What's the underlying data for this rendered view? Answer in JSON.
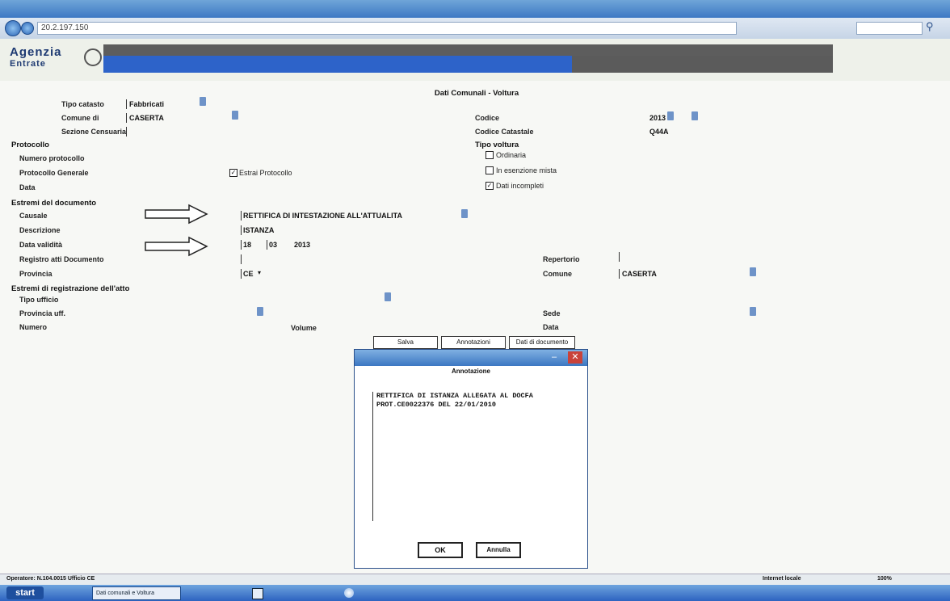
{
  "browser": {
    "url": "20.2.197.150",
    "search_icon": "magnifier-icon"
  },
  "app": {
    "logo_line1": "Agenzia",
    "logo_line2": "Entrate"
  },
  "form": {
    "title": "Dati Comunali - Voltura",
    "tipo_catasto_label": "Tipo catasto",
    "tipo_catasto_value": "Fabbricati",
    "comune_label": "Comune di",
    "comune_value": "CASERTA",
    "sezione_label": "Sezione Censuaria",
    "codice_label": "Codice",
    "codice_value": "2013",
    "codice_catastale_label": "Codice Catastale",
    "codice_catastale_value": "Q44A",
    "tipo_voltura_label": "Tipo voltura",
    "opt_ordinaria": "Ordinaria",
    "opt_mista": "In esenzione mista",
    "opt_dati": "Dati incompleti",
    "protocollo_label": "Protocollo",
    "numero_protocollo_label": "Numero protocollo",
    "protocollo_generale_label": "Protocollo Generale",
    "estrai_protocollo_label": "Estrai Protocollo",
    "data_label": "Data",
    "estremi_doc_label": "Estremi del documento",
    "causale_label": "Causale",
    "causale_value": "RETTIFICA DI INTESTAZIONE ALL'ATTUALITA",
    "descrizione_label": "Descrizione",
    "descrizione_value": "ISTANZA",
    "data_validita_label": "Data validità",
    "data_d": "18",
    "data_m": "03",
    "data_y": "2013",
    "registro_label": "Registro atti Documento",
    "repertorio_label": "Repertorio",
    "provincia_label": "Provincia",
    "provincia_value": "CE",
    "comune2_label": "Comune",
    "comune2_value": "CASERTA",
    "estremi_reg_label": "Estremi di registrazione dell'atto",
    "tipo_ufficio_label": "Tipo ufficio",
    "provincia_uff_label": "Provincia uff.",
    "sede_label": "Sede",
    "numero_label": "Numero",
    "volume_label": "Volume",
    "data2_label": "Data",
    "btn_salva": "Salva",
    "btn_annotazioni": "Annotazioni",
    "btn_dati_doc": "Dati di documento"
  },
  "dialog": {
    "title": "Annotazione",
    "text_line1": "RETTIFICA DI ISTANZA ALLEGATA AL DOCFA",
    "text_line2": "PROT.CE0022376 DEL 22/01/2010",
    "ok_label": "OK",
    "cancel_label": "Annulla"
  },
  "status": {
    "left": "Operatore: N.104.0015 Ufficio CE",
    "zone": "Internet locale",
    "zoom": "100%"
  },
  "taskbar": {
    "start": "start",
    "item": "Dati comunali e Voltura"
  }
}
